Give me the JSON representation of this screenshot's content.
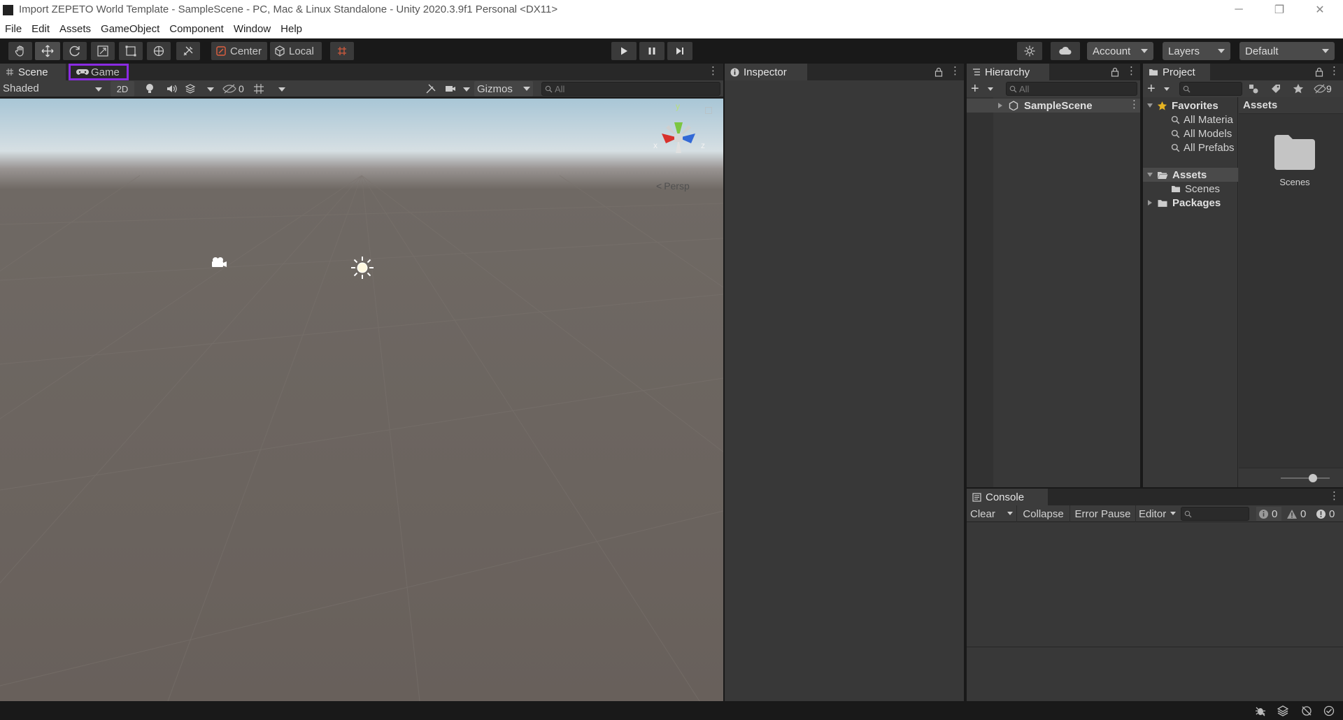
{
  "window": {
    "title": "Import ZEPETO World Template - SampleScene - PC, Mac & Linux Standalone - Unity 2020.3.9f1 Personal <DX11>"
  },
  "menu": [
    "File",
    "Edit",
    "Assets",
    "GameObject",
    "Component",
    "Window",
    "Help"
  ],
  "toolbar": {
    "pivot_label": "Center",
    "space_label": "Local",
    "account_label": "Account",
    "layers_label": "Layers",
    "layout_label": "Default"
  },
  "scene_panel": {
    "tabs": [
      "Scene",
      "Game"
    ],
    "shading_mode": "Shaded",
    "mode_2d": "2D",
    "hidden_count": "0",
    "gizmos_label": "Gizmos",
    "search_placeholder": "All",
    "persp_label": "Persp",
    "axis_labels": {
      "y": "y",
      "x": "x",
      "z": "z"
    }
  },
  "inspector": {
    "tab_label": "Inspector"
  },
  "hierarchy": {
    "tab_label": "Hierarchy",
    "search_placeholder": "All",
    "scene_name": "SampleScene"
  },
  "project": {
    "tab_label": "Project",
    "hidden_count": "9",
    "tree": {
      "favorites": "Favorites",
      "favorite_items": [
        "All Materia",
        "All Models",
        "All Prefabs"
      ],
      "assets": "Assets",
      "asset_children": [
        "Scenes"
      ],
      "packages": "Packages"
    },
    "breadcrumb": "Assets",
    "grid_items": [
      "Scenes"
    ]
  },
  "console": {
    "tab_label": "Console",
    "clear": "Clear",
    "collapse": "Collapse",
    "error_pause": "Error Pause",
    "editor": "Editor",
    "log_count": "0",
    "warn_count": "0",
    "error_count": "0"
  },
  "colors": {
    "highlight_box": "#8a2be2",
    "editor_bg": "#383838",
    "toolbar_bg": "#191919"
  }
}
